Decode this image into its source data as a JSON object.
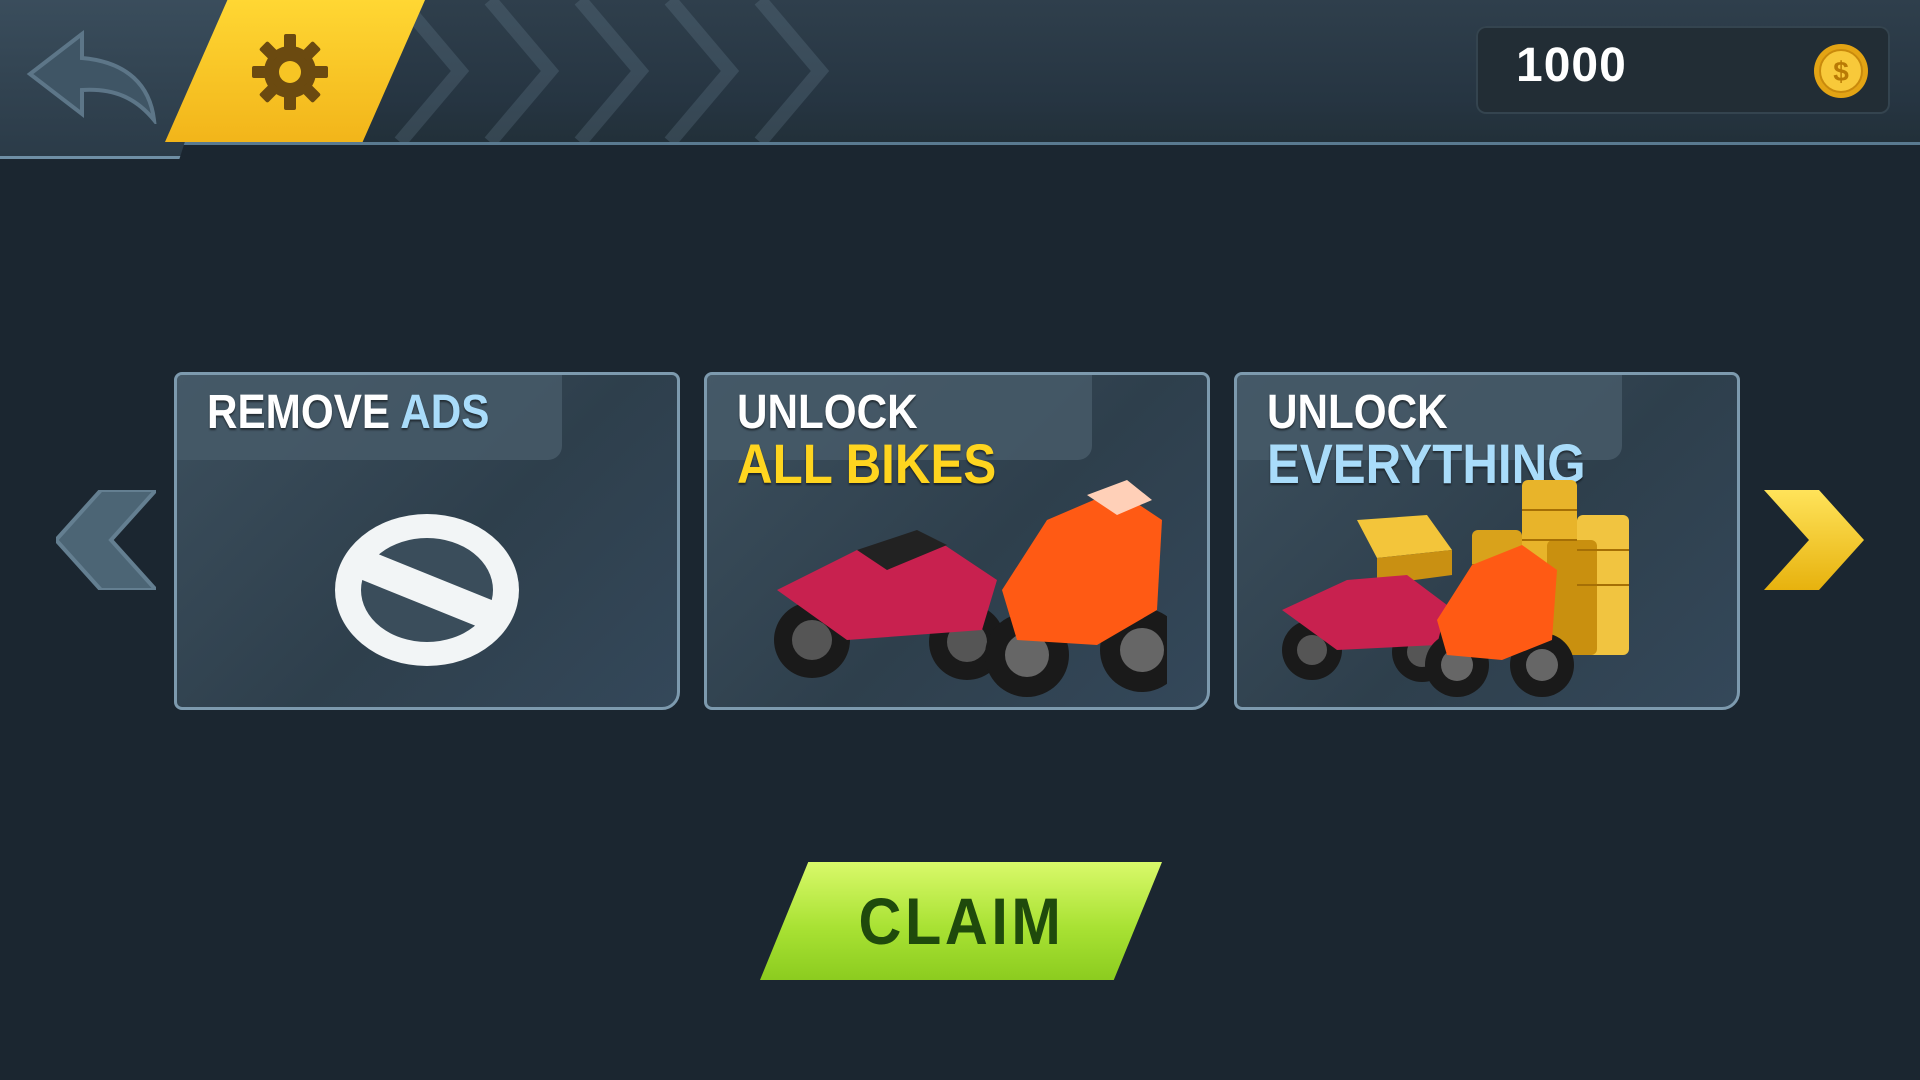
{
  "header": {
    "back_icon": "back-arrow-icon",
    "settings_icon": "gear-icon",
    "coins": "1000",
    "coin_icon": "gold-coin-icon"
  },
  "offers": [
    {
      "line1": "REMOVE ",
      "line2": "ADS",
      "image": "no-ads-icon"
    },
    {
      "line1": "UNLOCK",
      "line2": "ALL BIKES",
      "image": "motorcycles-image"
    },
    {
      "line1": "UNLOCK",
      "line2": "EVERYTHING",
      "image": "bikes-gold-coins-image"
    }
  ],
  "carousel": {
    "prev_icon": "chevron-left-icon",
    "next_icon": "chevron-right-icon"
  },
  "claim": {
    "label": "CLAIM"
  },
  "colors": {
    "background": "#1b2630",
    "accent_yellow": "#ffd51f",
    "accent_blue": "#a9dcfa",
    "claim_green": "#a9e234"
  }
}
